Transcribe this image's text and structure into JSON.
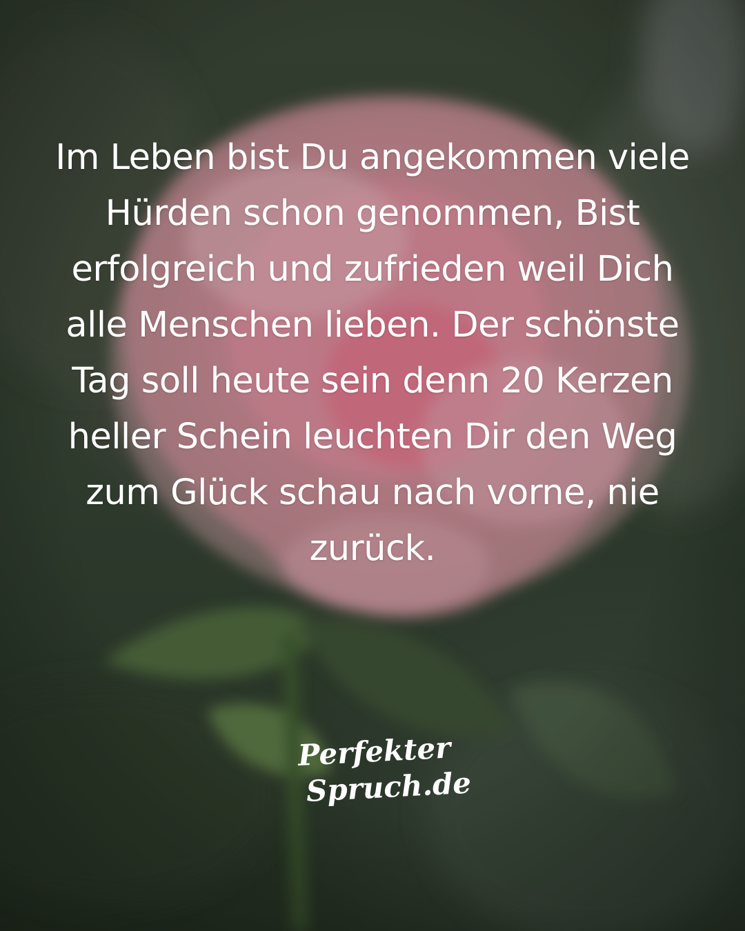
{
  "quote": {
    "lines": [
      "Im Leben bist Du angekommen viele",
      "Hürden schon genommen, Bist",
      "erfolgreich und zufrieden weil Dich",
      "alle Menschen lieben. Der schönste",
      "Tag soll heute sein denn 20 Kerzen",
      "heller Schein leuchten Dir den Weg",
      "zum Glück schau nach vorne, nie",
      "zurück."
    ]
  },
  "logo": {
    "line1": "Perfekter",
    "line2": "Spruch.de"
  },
  "colors": {
    "text": "#ffffff",
    "rose": "#e9a3b0",
    "background_green": "#344232"
  },
  "background": {
    "subject": "rose-photo"
  }
}
